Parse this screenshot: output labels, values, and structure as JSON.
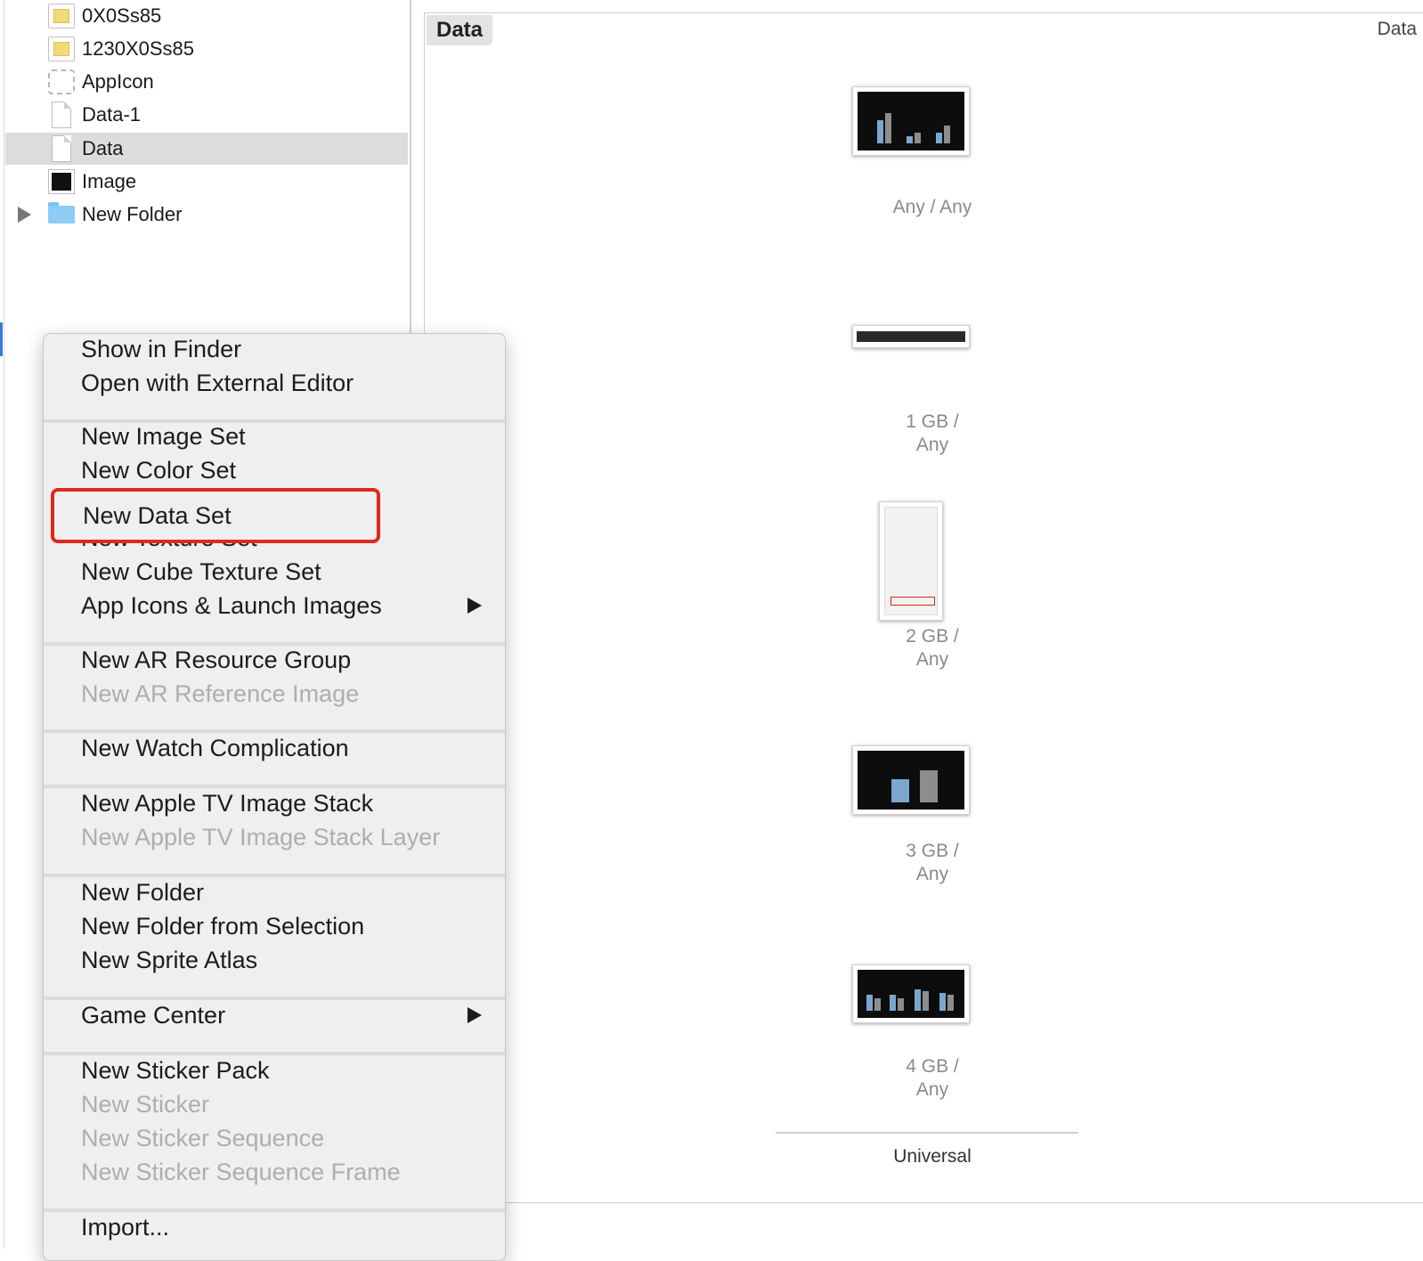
{
  "navigator": {
    "items": [
      {
        "label": "0X0Ss85",
        "icon": "image-set-icon"
      },
      {
        "label": "1230X0Ss85",
        "icon": "image-set-icon"
      },
      {
        "label": "AppIcon",
        "icon": "app-icon-set-icon"
      },
      {
        "label": "Data-1",
        "icon": "data-file-icon"
      },
      {
        "label": "Data",
        "icon": "data-file-icon",
        "selected": true
      },
      {
        "label": "Image",
        "icon": "image-icon"
      },
      {
        "label": "New Folder",
        "icon": "folder-icon",
        "expandable": true
      }
    ]
  },
  "editor": {
    "tab_label": "Data",
    "header_right": "Data",
    "slots": [
      {
        "line1": "Any / Any",
        "line2": ""
      },
      {
        "line1": "1 GB /",
        "line2": "Any"
      },
      {
        "line1": "2 GB /",
        "line2": "Any"
      },
      {
        "line1": "3 GB /",
        "line2": "Any"
      },
      {
        "line1": "4 GB /",
        "line2": "Any"
      }
    ],
    "group_label": "Universal"
  },
  "context_menu": {
    "items": [
      {
        "label": "Show in Finder",
        "enabled": true
      },
      {
        "label": "Open with External Editor",
        "enabled": true
      },
      {
        "label": "New Image Set",
        "enabled": true
      },
      {
        "label": "New Color Set",
        "enabled": true
      },
      {
        "label": "New Data Set",
        "enabled": true,
        "highlighted": true
      },
      {
        "label": "New Texture Set",
        "enabled": true
      },
      {
        "label": "New Cube Texture Set",
        "enabled": true
      },
      {
        "label": "App Icons & Launch Images",
        "enabled": true,
        "submenu": true
      },
      {
        "label": "New AR Resource Group",
        "enabled": true
      },
      {
        "label": "New AR Reference Image",
        "enabled": false
      },
      {
        "label": "New Watch Complication",
        "enabled": true
      },
      {
        "label": "New Apple TV Image Stack",
        "enabled": true
      },
      {
        "label": "New Apple TV Image Stack Layer",
        "enabled": false
      },
      {
        "label": "New Folder",
        "enabled": true
      },
      {
        "label": "New Folder from Selection",
        "enabled": true
      },
      {
        "label": "New Sprite Atlas",
        "enabled": true
      },
      {
        "label": "Game Center",
        "enabled": true,
        "submenu": true
      },
      {
        "label": "New Sticker Pack",
        "enabled": true
      },
      {
        "label": "New Sticker",
        "enabled": false
      },
      {
        "label": "New Sticker Sequence",
        "enabled": false
      },
      {
        "label": "New Sticker Sequence Frame",
        "enabled": false
      },
      {
        "label": "Import...",
        "enabled": true
      }
    ]
  },
  "colors": {
    "highlight_border": "#e0281c",
    "disabled_text": "#aeaeae",
    "selection_bg": "#dcdcdc"
  }
}
